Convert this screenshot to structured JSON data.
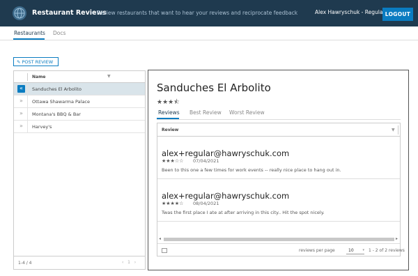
{
  "header": {
    "title": "Restaurant Reviews",
    "subtitle": "— Review restaurants that want to hear your reviews and reciprocate feedback",
    "user": "Alex Hawryschuk - Regular",
    "logout_label": "LOGOUT",
    "colors": {
      "bar": "#1f3a4f",
      "accent": "#0a7cc1"
    }
  },
  "nav": {
    "tabs": [
      {
        "label": "Restaurants",
        "active": true
      },
      {
        "label": "Docs",
        "active": false
      }
    ]
  },
  "toolbar": {
    "post_review_label": "POST REVIEW",
    "post_review_icon": "edit-icon"
  },
  "restaurants": {
    "column_name": "Name",
    "items": [
      {
        "name": "Sanduches El Arbolito",
        "selected": true
      },
      {
        "name": "Ottawa Shawarma Palace",
        "selected": false
      },
      {
        "name": "Montana's BBQ & Bar",
        "selected": false
      },
      {
        "name": "Harvey's",
        "selected": false
      }
    ],
    "count_text": "1-4 / 4",
    "page": "1"
  },
  "detail": {
    "title": "Sanduches El Arbolito",
    "rating": 3.5,
    "tabs": [
      {
        "label": "Reviews",
        "active": true
      },
      {
        "label": "Best Review",
        "active": false
      },
      {
        "label": "Worst Review",
        "active": false
      }
    ],
    "grid": {
      "column": "Review",
      "reviews": [
        {
          "author": "alex+regular@hawryschuk.com",
          "rating": 3,
          "date": "07/04/2021",
          "text": "Been to this one a few times for work events -- really nice place to hang out in."
        },
        {
          "author": "alex+regular@hawryschuk.com",
          "rating": 4,
          "date": "08/04/2021",
          "text": "Twas the first place I ate at after arriving in this city.. Hit the spot nicely."
        }
      ],
      "per_page_label": "reviews per page",
      "per_page_value": "10",
      "range_text": "1 - 2 of 2 reviews"
    }
  }
}
